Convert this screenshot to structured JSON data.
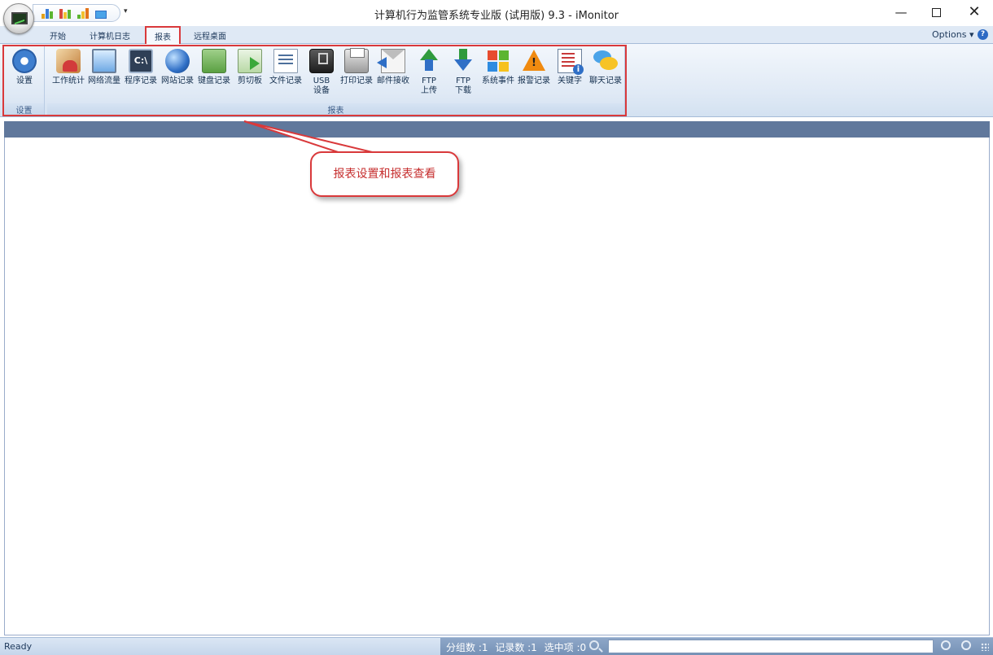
{
  "window": {
    "title": "计算机行为监管系统专业版 (试用版) 9.3 - iMonitor",
    "minimize": "—",
    "close": "✕"
  },
  "qat": {
    "dropdown_icon": "chevron-down-icon"
  },
  "tabs": {
    "start": "开始",
    "computer_log": "计算机日志",
    "report": "报表",
    "remote_desktop": "远程桌面"
  },
  "options": {
    "label": "Options ▾",
    "help": "?"
  },
  "ribbon": {
    "settings_group": {
      "label": "设置",
      "button_label": "设置"
    },
    "report_group": {
      "label": "报表",
      "buttons": [
        {
          "label": "工作统计",
          "icon": "users-icon"
        },
        {
          "label": "网络流量",
          "icon": "monitors-icon"
        },
        {
          "label": "程序记录",
          "icon": "command-prompt-icon",
          "glyph": "C:\\"
        },
        {
          "label": "网站记录",
          "icon": "globe-icon"
        },
        {
          "label": "键盘记录",
          "icon": "keyboard-icon"
        },
        {
          "label": "剪切板",
          "icon": "clipboard-icon"
        },
        {
          "label": "文件记录",
          "icon": "file-icon"
        },
        {
          "label": "USB",
          "label2": "设备",
          "icon": "usb-icon"
        },
        {
          "label": "打印记录",
          "icon": "printer-icon"
        },
        {
          "label": "邮件接收",
          "icon": "mail-icon"
        },
        {
          "label": "FTP",
          "label2": "上传",
          "icon": "upload-icon"
        },
        {
          "label": "FTP",
          "label2": "下载",
          "icon": "download-icon"
        },
        {
          "label": "系统事件",
          "icon": "windows-icon"
        },
        {
          "label": "报警记录",
          "icon": "warning-icon"
        },
        {
          "label": "关键字",
          "icon": "keyword-icon"
        },
        {
          "label": "聊天记录",
          "icon": "chat-icon"
        }
      ]
    }
  },
  "callout": {
    "text": "报表设置和报表查看"
  },
  "status": {
    "ready": "Ready",
    "group_count": "分组数 :1",
    "record_count": "记录数 :1",
    "selected_count": "选中项 :0"
  },
  "colors": {
    "accent_red": "#d9393b",
    "content_header": "#60789c",
    "status_right": "#7490b5"
  }
}
